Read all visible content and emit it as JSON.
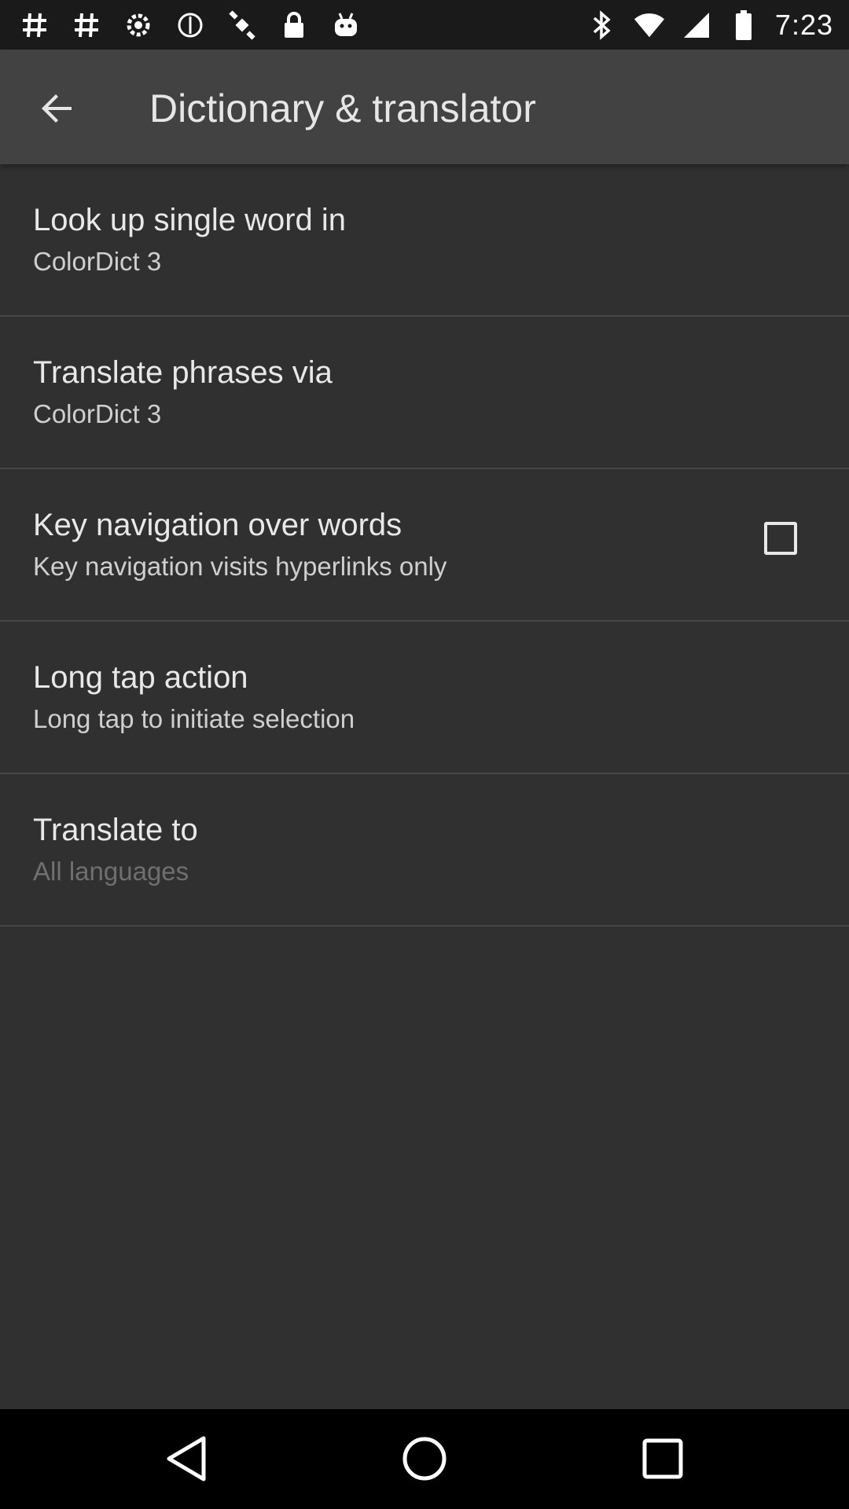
{
  "status_bar": {
    "time": "7:23",
    "left_icons": [
      "hash-icon",
      "hash-icon",
      "settings-icon",
      "help-icon",
      "satellite-icon",
      "lock-icon",
      "android-icon"
    ],
    "right_icons": [
      "bluetooth-icon",
      "wifi-icon",
      "signal-icon",
      "battery-icon"
    ]
  },
  "app_bar": {
    "title": "Dictionary & translator",
    "back_icon": "arrow-back-icon"
  },
  "preferences": [
    {
      "title": "Look up single word in",
      "summary": "ColorDict 3",
      "has_checkbox": false
    },
    {
      "title": "Translate phrases via",
      "summary": "ColorDict 3",
      "has_checkbox": false
    },
    {
      "title": "Key navigation over words",
      "summary": "Key navigation visits hyperlinks only",
      "has_checkbox": true,
      "checked": false
    },
    {
      "title": "Long tap action",
      "summary": "Long tap to initiate selection",
      "has_checkbox": false
    },
    {
      "title": "Translate to",
      "summary": "All languages",
      "has_checkbox": false,
      "summary_disabled": true
    }
  ],
  "nav_bar": {
    "icons": [
      "back-triangle-icon",
      "home-circle-icon",
      "recents-square-icon"
    ]
  },
  "colors": {
    "background": "#303030",
    "app_bar": "#424242",
    "status_bar": "#1a1a1a",
    "nav_bar": "#000000"
  }
}
